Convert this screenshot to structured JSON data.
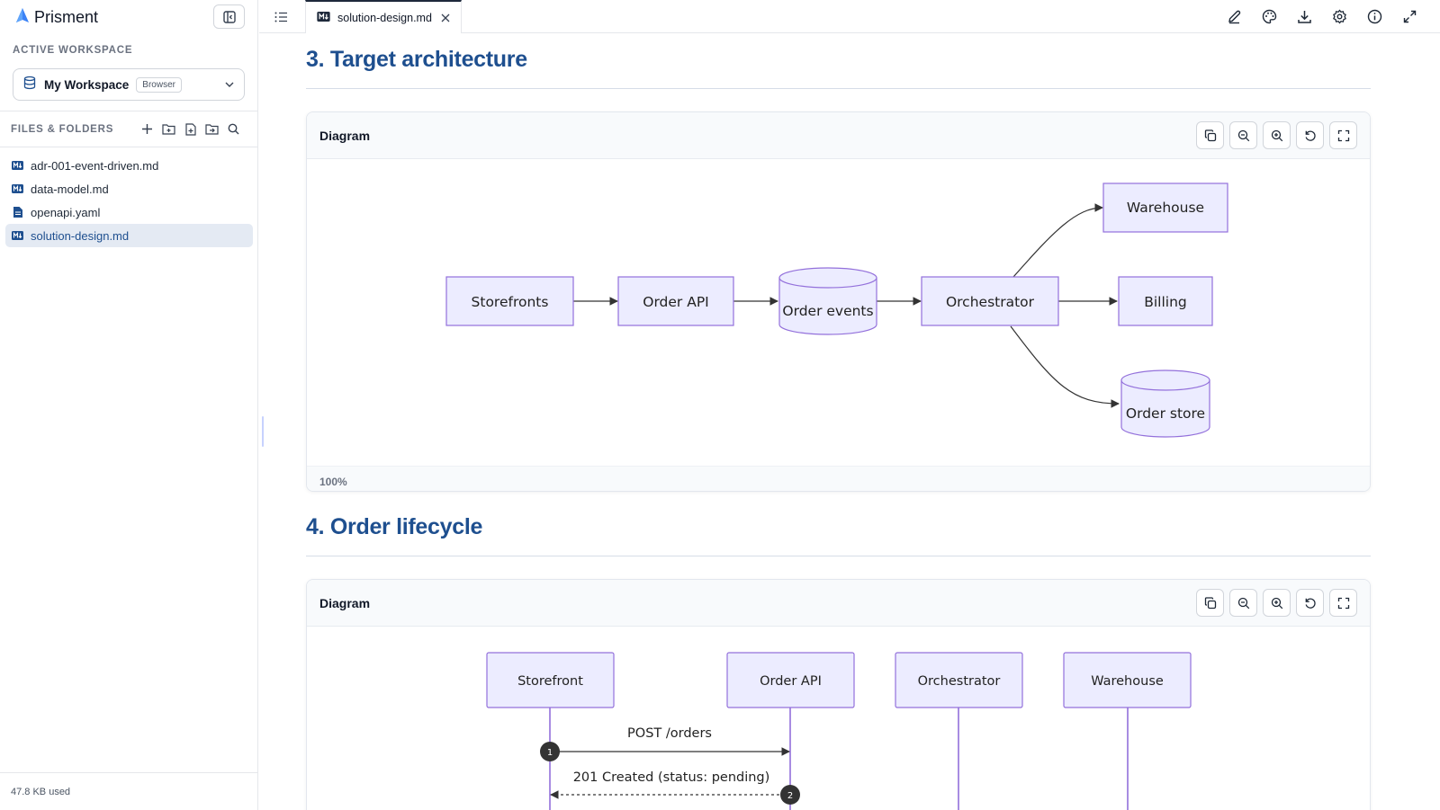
{
  "app": {
    "name": "Prisment"
  },
  "sidebar": {
    "workspace_label": "ACTIVE WORKSPACE",
    "workspace_name": "My Workspace",
    "workspace_badge": "Browser",
    "files_label": "FILES & FOLDERS",
    "files": [
      {
        "name": "adr-001-event-driven.md",
        "icon": "markdown-icon"
      },
      {
        "name": "data-model.md",
        "icon": "markdown-icon"
      },
      {
        "name": "openapi.yaml",
        "icon": "file-icon"
      },
      {
        "name": "solution-design.md",
        "icon": "markdown-icon",
        "active": true
      }
    ],
    "storage_used": "47.8 KB used"
  },
  "topbar": {
    "tab_label": "solution-design.md",
    "actions": [
      "edit-icon",
      "palette-icon",
      "download-icon",
      "settings-icon",
      "info-icon",
      "expand-icon"
    ]
  },
  "sections": [
    {
      "heading": "3. Target architecture",
      "diagram": {
        "title": "Diagram",
        "zoom": "100%",
        "nodes": [
          "Storefronts",
          "Order API",
          "Order events",
          "Orchestrator",
          "Warehouse",
          "Billing",
          "Order store"
        ]
      }
    },
    {
      "heading": "4. Order lifecycle",
      "diagram": {
        "title": "Diagram",
        "participants": [
          "Storefront",
          "Order API",
          "Orchestrator",
          "Warehouse"
        ],
        "messages": [
          {
            "num": "1",
            "text": "POST /orders"
          },
          {
            "num": "2",
            "text": "201 Created (status: pending)"
          }
        ]
      }
    }
  ],
  "colors": {
    "accent": "#1e4f8f",
    "node_fill": "#ececff",
    "node_stroke": "#9370db"
  }
}
